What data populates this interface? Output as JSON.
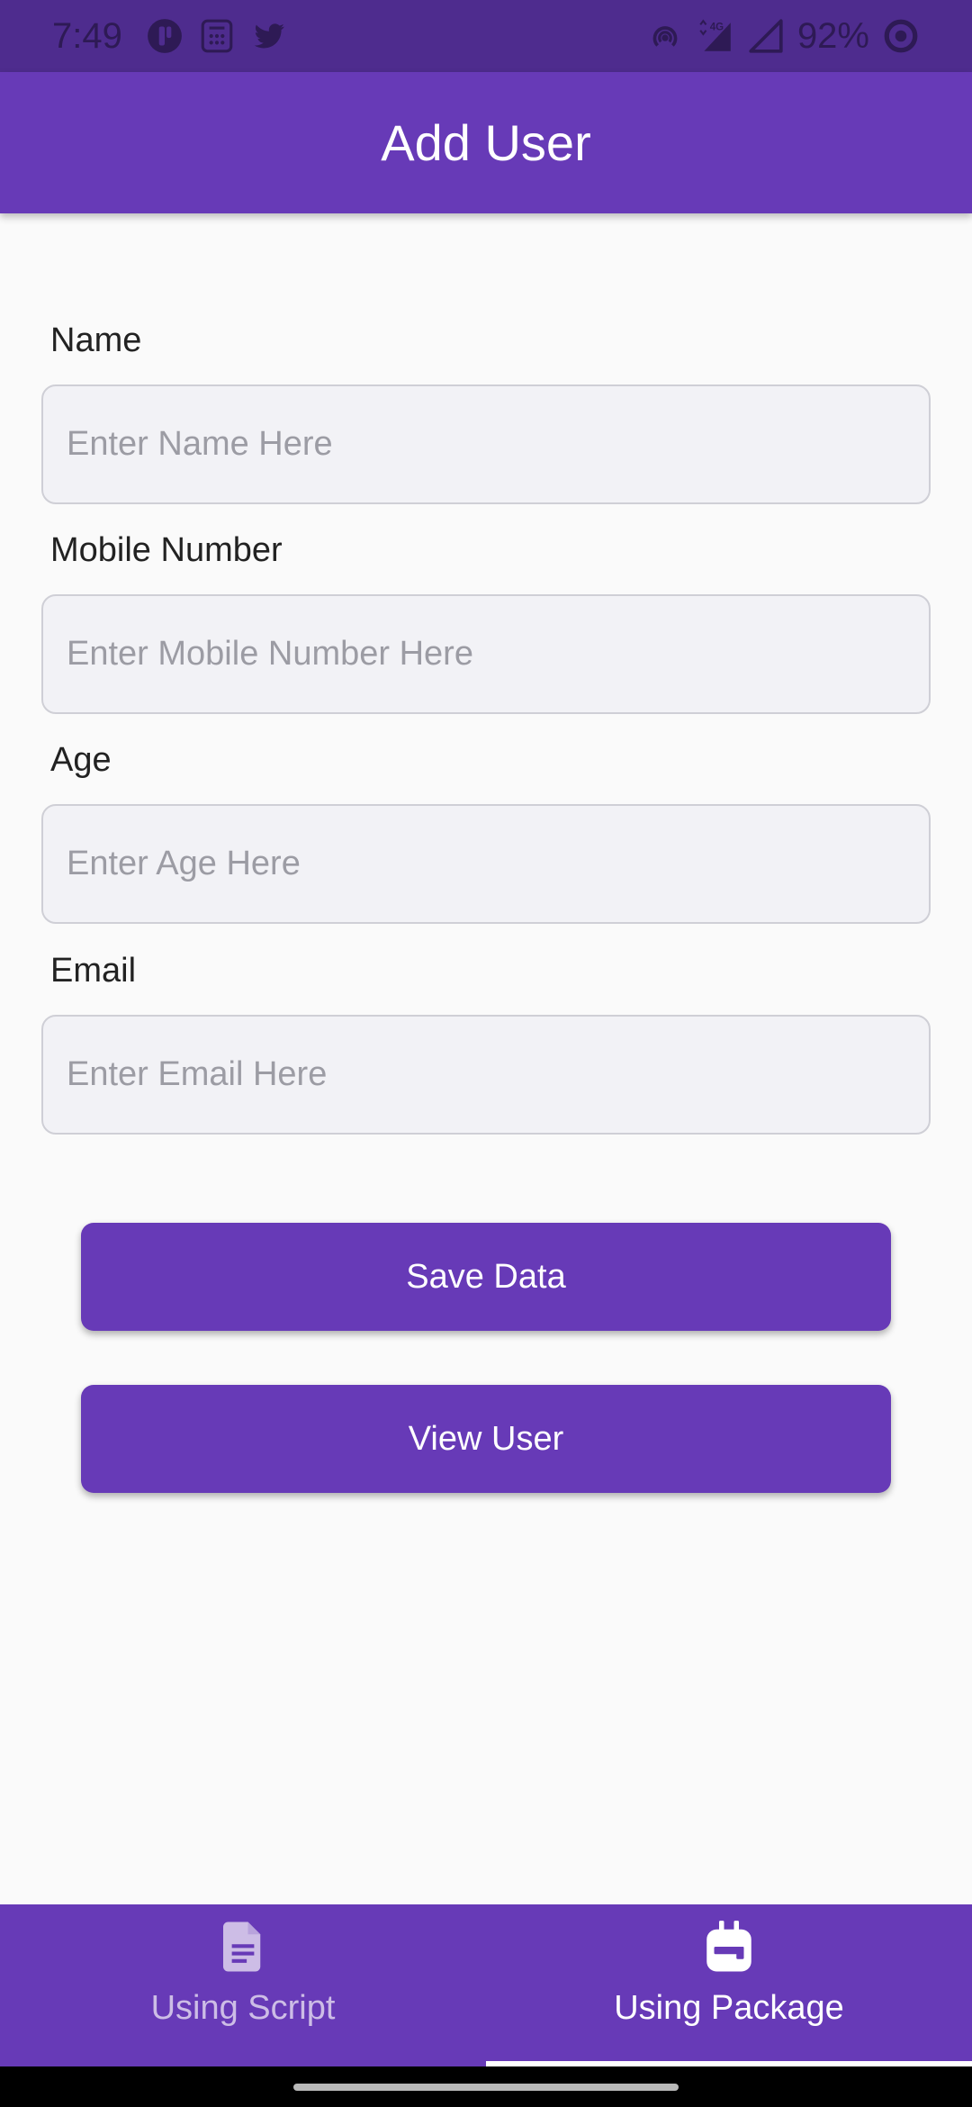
{
  "status_bar": {
    "time": "7:49",
    "battery": "92%",
    "left_icons": [
      "notification-app-icon",
      "calculator-icon",
      "twitter-icon"
    ],
    "right_icons": [
      "hotspot-icon",
      "signal-4g-icon",
      "signal-icon",
      "battery-saver-icon"
    ],
    "network_type": "4G"
  },
  "app_bar": {
    "title": "Add User"
  },
  "form": {
    "fields": [
      {
        "label": "Name",
        "placeholder": "Enter Name Here",
        "value": ""
      },
      {
        "label": "Mobile Number",
        "placeholder": "Enter Mobile Number Here",
        "value": ""
      },
      {
        "label": "Age",
        "placeholder": "Enter Age Here",
        "value": ""
      },
      {
        "label": "Email",
        "placeholder": "Enter Email Here",
        "value": ""
      }
    ]
  },
  "buttons": {
    "save_label": "Save Data",
    "view_label": "View User"
  },
  "bottom_nav": {
    "items": [
      {
        "label": "Using Script",
        "icon": "document-icon",
        "active": false
      },
      {
        "label": "Using Package",
        "icon": "package-icon",
        "active": true
      }
    ]
  },
  "colors": {
    "primary": "#673ab7",
    "status_bar": "#4e2c8e",
    "background": "#fafafa",
    "input_fill": "#f2f2f6",
    "input_border": "#cfcfd6"
  }
}
